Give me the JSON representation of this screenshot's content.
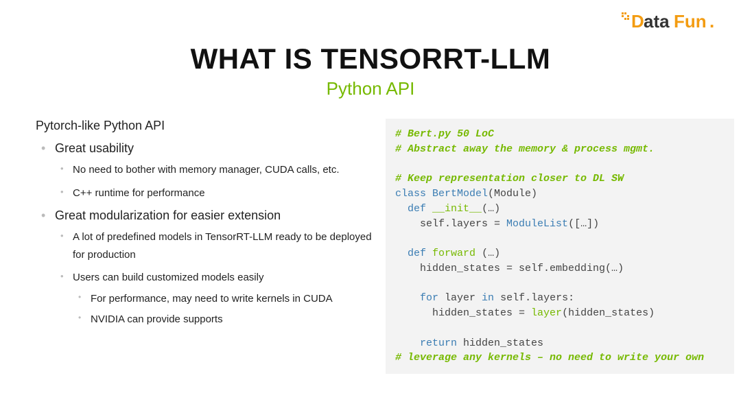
{
  "logo_text": "DataFun.",
  "title": "WHAT IS TENSORRT-LLM",
  "subtitle": "Python API",
  "intro": "Pytorch-like Python API",
  "bullets": {
    "b0": "Great usability",
    "b0_0": "No need to bother with memory manager, CUDA calls, etc.",
    "b0_1": "C++ runtime for performance",
    "b1": "Great modularization for easier extension",
    "b1_0": "A lot of predefined models in TensorRT-LLM ready to be deployed for production",
    "b1_1": "Users can build customized models easily",
    "b1_1_0": "For performance, may need to write kernels in CUDA",
    "b1_1_1": "NVIDIA can provide supports"
  },
  "code": {
    "c1": "# Bert.py 50 LoC",
    "c2": "# Abstract away the memory & process mgmt.",
    "c3": "# Keep representation closer to DL SW",
    "kw_class": "class",
    "cls_name": "BertModel",
    "base": "(Module)",
    "kw_def1": "def",
    "init_name": "__init__",
    "init_args": "(…)",
    "init_body": "self.layers = ",
    "modulelist": "ModuleList",
    "modulelist_args": "([…])",
    "kw_def2": "def",
    "fwd_name": "forward",
    "fwd_args": " (…)",
    "fwd_l1": "hidden_states = self.embedding(…)",
    "kw_for": "for",
    "loop_var": " layer ",
    "kw_in": "in",
    "loop_iter": " self.layers:",
    "loop_body_pre": "hidden_states = ",
    "layer_call": "layer",
    "loop_body_post": "(hidden_states)",
    "kw_return": "return",
    "ret_val": " hidden_states",
    "c4": "# leverage any kernels – no need to write your own"
  }
}
